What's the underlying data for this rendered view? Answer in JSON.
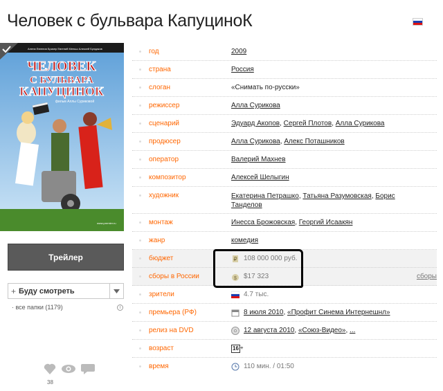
{
  "title": "Человек с бульвара КапуциноК",
  "poster": {
    "line1": "ЧЕЛОВЕК",
    "line2": "С БУЛЬВАРА",
    "line3": "КАПУЦИНОК",
    "tagline": "фильм Аллы Суриковой"
  },
  "trailer_label": "Трейлер",
  "watch": {
    "label": "Буду смотреть",
    "plus": "+"
  },
  "folders_label": "все папки (1179)",
  "likes_count": "38",
  "info": {
    "year": {
      "k": "год",
      "v": "2009"
    },
    "country": {
      "k": "страна",
      "v": "Россия"
    },
    "slogan": {
      "k": "слоган",
      "v": "«Снимать по-русски»"
    },
    "director": {
      "k": "режиссер",
      "v": "Алла Сурикова"
    },
    "writers": {
      "k": "сценарий",
      "v1": "Эдуард Акопов",
      "v2": "Сергей Плотов",
      "v3": "Алла Сурикова"
    },
    "producers": {
      "k": "продюсер",
      "v1": "Алла Сурикова",
      "v2": "Алекс Поташников"
    },
    "operator": {
      "k": "оператор",
      "v": "Валерий Махнев"
    },
    "composer": {
      "k": "композитор",
      "v": "Алексей Шелыгин"
    },
    "artists": {
      "k": "художник",
      "v1": "Екатерина Петрашко",
      "v2": "Татьяна Разумовская",
      "v3a": "Борис",
      "v3b": "Танделов"
    },
    "editing": {
      "k": "монтаж",
      "v1": "Инесса Брожовская",
      "v2": "Георгий Исаакян"
    },
    "genre": {
      "k": "жанр",
      "v": "комедия"
    },
    "budget": {
      "k": "бюджет",
      "v": "108 000 000 руб."
    },
    "box_office": {
      "k": "сборы в России",
      "v": "$17 323",
      "right": "сборы"
    },
    "viewers": {
      "k": "зрители",
      "v": "4.7 тыс."
    },
    "premiere": {
      "k": "премьера (РФ)",
      "v1": "8 июля 2010",
      "v2": "«Профит Синема Интернешнл»"
    },
    "dvd": {
      "k": "релиз на DVD",
      "v1": "12 августа 2010",
      "v2": "«Союз-Видео»",
      "v3": "..."
    },
    "age": {
      "k": "возраст",
      "badge": "16",
      "plus": "+"
    },
    "time": {
      "k": "время",
      "v": "110 мин. / 01:50"
    }
  },
  "colors": {
    "label": "#ff6600",
    "accent_dark": "#5a5a5a"
  }
}
